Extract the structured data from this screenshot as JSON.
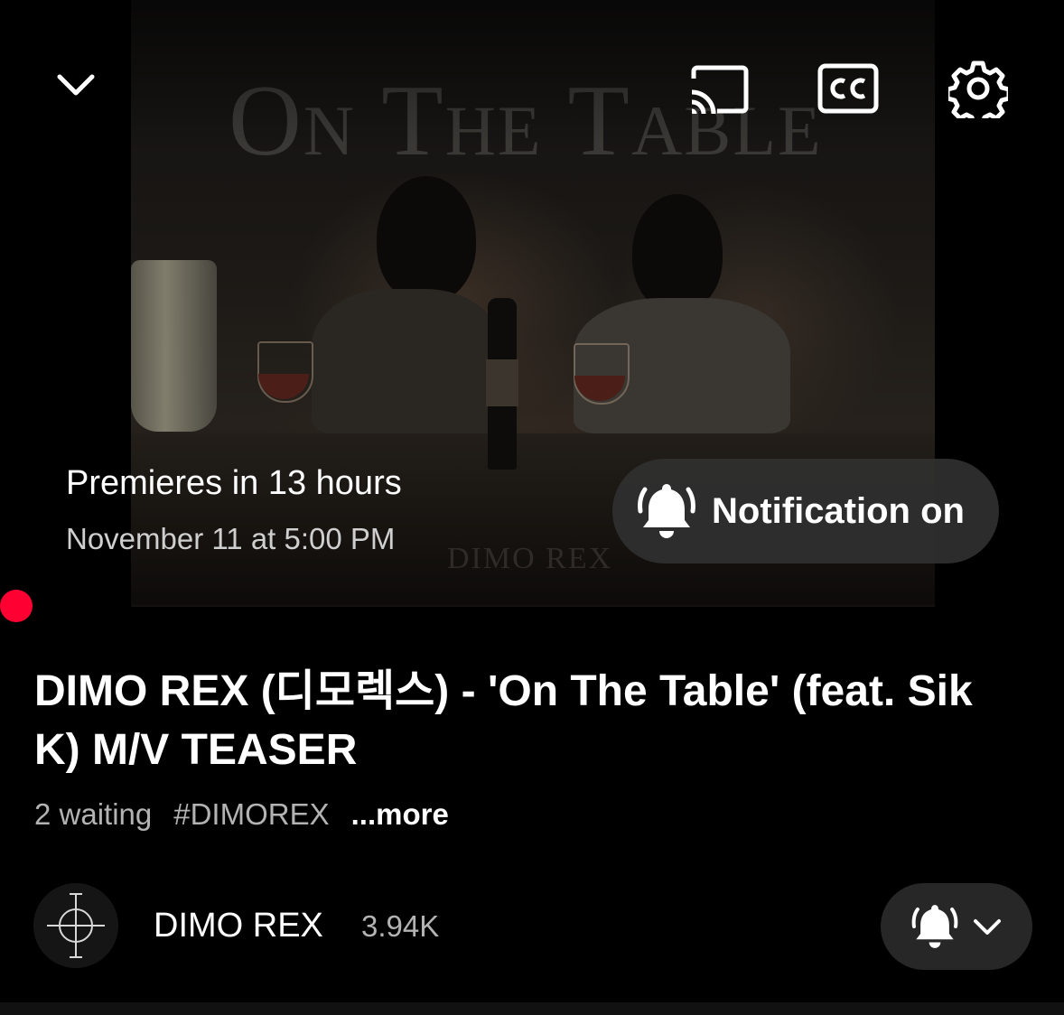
{
  "player": {
    "thumbnail_title": "On The Table",
    "thumbnail_credit": "DIMO REX",
    "premiere_text": "Premieres in 13 hours",
    "premiere_date": "November 11 at 5:00 PM",
    "notification_label": "Notification on",
    "icons": [
      "chevron-down-icon",
      "cast-icon",
      "closed-captions-icon",
      "settings-gear-icon",
      "bell-ringing-icon"
    ]
  },
  "video": {
    "title": "DIMO REX (디모렉스) - 'On The Table' (feat. Sik K) M/V TEASER",
    "waiting": "2 waiting",
    "hashtag": "#DIMOREX",
    "more": "...more"
  },
  "channel": {
    "name": "DIMO REX",
    "subscribers": "3.94K"
  },
  "colors": {
    "live_dot": "#ff0033",
    "pill_bg": "#303030",
    "secondary_text": "#b3b3b3"
  }
}
